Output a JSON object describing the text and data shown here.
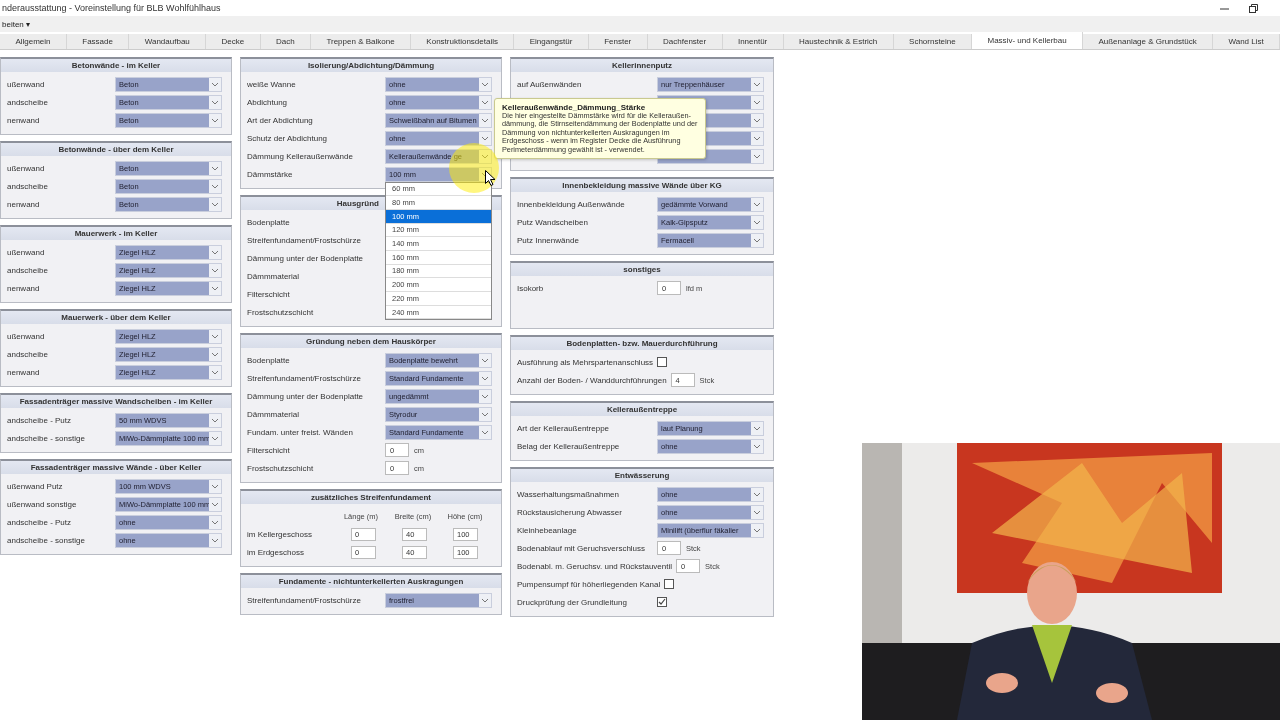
{
  "window": {
    "title": "nderausstattung - Voreinstellung für BLB Wohlfühlhaus"
  },
  "menu": [
    "beiten ▾"
  ],
  "tabs": [
    {
      "label": "Allgemein",
      "selected": false
    },
    {
      "label": "Fassade",
      "selected": false
    },
    {
      "label": "Wandaufbau",
      "selected": false
    },
    {
      "label": "Decke",
      "selected": false
    },
    {
      "label": "Dach",
      "selected": false
    },
    {
      "label": "Treppen & Balkone",
      "selected": false
    },
    {
      "label": "Konstruktionsdetails",
      "selected": false
    },
    {
      "label": "Eingangstür",
      "selected": false
    },
    {
      "label": "Fenster",
      "selected": false
    },
    {
      "label": "Dachfenster",
      "selected": false
    },
    {
      "label": "Innentür",
      "selected": false
    },
    {
      "label": "Haustechnik & Estrich",
      "selected": false
    },
    {
      "label": "Schornsteine",
      "selected": false
    },
    {
      "label": "Massiv- und Kellerbau",
      "selected": true
    },
    {
      "label": "Außenanlage & Grundstück",
      "selected": false
    },
    {
      "label": "Wand List",
      "selected": false
    }
  ],
  "columns": [
    {
      "sections": [
        {
          "title": "Betonwände - im Keller",
          "rows": [
            {
              "kind": "select",
              "label": "ußenwand",
              "value": "Beton"
            },
            {
              "kind": "select",
              "label": "andscheibe",
              "value": "Beton"
            },
            {
              "kind": "select",
              "label": "nenwand",
              "value": "Beton"
            }
          ]
        },
        {
          "title": "Betonwände - über dem Keller",
          "rows": [
            {
              "kind": "select",
              "label": "ußenwand",
              "value": "Beton"
            },
            {
              "kind": "select",
              "label": "andscheibe",
              "value": "Beton"
            },
            {
              "kind": "select",
              "label": "nenwand",
              "value": "Beton"
            }
          ]
        },
        {
          "title": "Mauerwerk - im Keller",
          "rows": [
            {
              "kind": "select",
              "label": "ußenwand",
              "value": "Ziegel HLZ"
            },
            {
              "kind": "select",
              "label": "andscheibe",
              "value": "Ziegel HLZ"
            },
            {
              "kind": "select",
              "label": "nenwand",
              "value": "Ziegel HLZ"
            }
          ]
        },
        {
          "title": "Mauerwerk - über dem Keller",
          "rows": [
            {
              "kind": "select",
              "label": "ußenwand",
              "value": "Ziegel HLZ"
            },
            {
              "kind": "select",
              "label": "andscheibe",
              "value": "Ziegel HLZ"
            },
            {
              "kind": "select",
              "label": "nenwand",
              "value": "Ziegel HLZ"
            }
          ]
        },
        {
          "title": "Fassadenträger massive Wandscheiben - im Keller",
          "rows": [
            {
              "kind": "select",
              "label": "andscheibe - Putz",
              "value": "50 mm WDVS"
            },
            {
              "kind": "select",
              "label": "andscheibe - sonstige",
              "value": "MiWo-Dämmplatte 100 mm"
            }
          ]
        },
        {
          "title": "Fassadenträger massive Wände - über Keller",
          "rows": [
            {
              "kind": "select",
              "label": "ußenwand Putz",
              "value": "100 mm WDVS"
            },
            {
              "kind": "select",
              "label": "ußenwand sonstige",
              "value": "MiWo-Dämmplatte 100 mm"
            },
            {
              "kind": "select",
              "label": "andscheibe - Putz",
              "value": "ohne"
            },
            {
              "kind": "select",
              "label": "andscheibe - sonstige",
              "value": "ohne"
            }
          ]
        }
      ]
    },
    {
      "sections": [
        {
          "title": "Isolierung/Abdichtung/Dämmung",
          "rows": [
            {
              "kind": "select",
              "label": "weiße Wanne",
              "value": "ohne"
            },
            {
              "kind": "select",
              "label": "Abdichtung",
              "value": "ohne"
            },
            {
              "kind": "select",
              "label": "Art der Abdichtung",
              "value": "Schweißbahn auf Bitumen"
            },
            {
              "kind": "select",
              "label": "Schutz der Abdichtung",
              "value": "ohne"
            },
            {
              "kind": "select",
              "label": "Dämmung Kelleraußenwände",
              "value": "Kelleraußenwände ge"
            },
            {
              "kind": "select",
              "label": "Dämmstärke",
              "value": "100 mm",
              "expanded": true,
              "options": [
                {
                  "label": "60 mm",
                  "selected": false
                },
                {
                  "label": "80 mm",
                  "selected": false
                },
                {
                  "label": "100 mm",
                  "selected": true
                },
                {
                  "label": "120 mm",
                  "selected": false
                },
                {
                  "label": "140 mm",
                  "selected": false
                },
                {
                  "label": "160 mm",
                  "selected": false
                },
                {
                  "label": "180 mm",
                  "selected": false
                },
                {
                  "label": "200 mm",
                  "selected": false
                },
                {
                  "label": "220 mm",
                  "selected": false
                },
                {
                  "label": "240 mm",
                  "selected": false
                }
              ]
            }
          ]
        },
        {
          "title": "Hausgründ",
          "rows": [
            {
              "kind": "label",
              "label": "Bodenplatte"
            },
            {
              "kind": "label",
              "label": "Streifenfundament/Frostschürze"
            },
            {
              "kind": "label",
              "label": "Dämmung unter der Bodenplatte"
            },
            {
              "kind": "label",
              "label": "Dämmmaterial"
            },
            {
              "kind": "label",
              "label": "Filterschicht"
            },
            {
              "kind": "label",
              "label": "Frostschutzschicht"
            }
          ]
        },
        {
          "title": "Gründung neben dem Hauskörper",
          "rows": [
            {
              "kind": "select",
              "label": "Bodenplatte",
              "value": "Bodenplatte bewehrt"
            },
            {
              "kind": "select",
              "label": "Streifenfundament/Frostschürze",
              "value": "Standard Fundamente"
            },
            {
              "kind": "select",
              "label": "Dämmung unter der Bodenplatte",
              "value": "ungedämmt"
            },
            {
              "kind": "select",
              "label": "Dämmmaterial",
              "value": "Styrodur"
            },
            {
              "kind": "select",
              "label": "Fundam. unter freist. Wänden",
              "value": "Standard Fundamente"
            },
            {
              "kind": "number",
              "label": "Filterschicht",
              "value": "0",
              "unit": "cm"
            },
            {
              "kind": "number",
              "label": "Frostschutzschicht",
              "value": "0",
              "unit": "cm"
            }
          ]
        },
        {
          "title": "zusätzliches Streifenfundament",
          "rows": [
            {
              "kind": "head",
              "values": [
                "Länge (m)",
                "Breite (cm)",
                "Höhe (cm)"
              ]
            },
            {
              "kind": "triple",
              "label": "im Kellergeschoss",
              "values": [
                "0",
                "40",
                "100"
              ]
            },
            {
              "kind": "triple",
              "label": "im Erdgeschoss",
              "values": [
                "0",
                "40",
                "100"
              ]
            }
          ]
        },
        {
          "title": "Fundamente - nichtunterkellerten Auskragungen",
          "rows": [
            {
              "kind": "select",
              "label": "Streifenfundament/Frostschürze",
              "value": "frostfrei"
            }
          ]
        }
      ]
    },
    {
      "sections": [
        {
          "title": "Kellerinnenputz",
          "rows": [
            {
              "kind": "select",
              "label": "auf Außenwänden",
              "value": "nur Treppenhäuser"
            },
            {
              "kind": "select"
            },
            {
              "kind": "select"
            },
            {
              "kind": "select"
            },
            {
              "kind": "select"
            }
          ]
        },
        {
          "title": "Innenbekleidung massive Wände über KG",
          "rows": [
            {
              "kind": "select",
              "label": "Innenbekleidung Außenwände",
              "value": "gedämmte Vorwand"
            },
            {
              "kind": "select",
              "label": "Putz Wandscheiben",
              "value": "Kalk-Gipsputz"
            },
            {
              "kind": "select",
              "label": "Putz Innenwände",
              "value": "Fermacell"
            }
          ]
        },
        {
          "title": "sonstiges",
          "rows": [
            {
              "kind": "number",
              "label": "Isokorb",
              "value": "0",
              "unit": "lfd m"
            },
            {
              "kind": "spacer"
            }
          ]
        },
        {
          "title": "Bodenplatten- bzw. Mauerdurchführung",
          "rows": [
            {
              "kind": "checkbox",
              "label": "Ausführung als Mehrspartenanschluss",
              "checked": false
            },
            {
              "kind": "number",
              "label": "Anzahl der Boden- / Wanddurchführungen",
              "value": "4",
              "unit": "Stck"
            }
          ]
        },
        {
          "title": "Kelleraußentreppe",
          "rows": [
            {
              "kind": "select",
              "label": "Art der Kelleraußentreppe",
              "value": "laut Planung"
            },
            {
              "kind": "select",
              "label": "Belag der Kelleraußentreppe",
              "value": "ohne"
            }
          ]
        },
        {
          "title": "Entwässerung",
          "rows": [
            {
              "kind": "select",
              "label": "Wasserhaltungsmaßnahmen",
              "value": "ohne"
            },
            {
              "kind": "select",
              "label": "Rückstausicherung Abwasser",
              "value": "ohne"
            },
            {
              "kind": "select",
              "label": "Kleinhebeanlage",
              "value": "Minilift (überflur fäkalier"
            },
            {
              "kind": "number",
              "label": "Bodenablauf mit Geruchsverschluss",
              "value": "0",
              "unit": "Stck"
            },
            {
              "kind": "number",
              "label": "Bodenabl. m. Geruchsv. und Rückstauventil",
              "value": "0",
              "unit": "Stck"
            },
            {
              "kind": "checkbox",
              "label": "Pumpensumpf für höherliegenden Kanal",
              "checked": false
            },
            {
              "kind": "checkbox",
              "label": "Druckprüfung der Grundleitung",
              "checked": true
            }
          ]
        }
      ]
    }
  ],
  "tooltip": {
    "title": "Kelleraußenwände_Dämmung_Stärke",
    "text": "Die hier eingestellte Dämmstärke wird für die Kelleraußen-dämmung, die Stirnseitendämmung der Bodenplatte und der Dämmung von nichtunterkellerten Auskragungen im Erdgeschoss - wenn im Register Decke die Ausführung Perimeterdämmung gewählt ist - verwendet."
  },
  "video": {
    "kind": "picture"
  }
}
